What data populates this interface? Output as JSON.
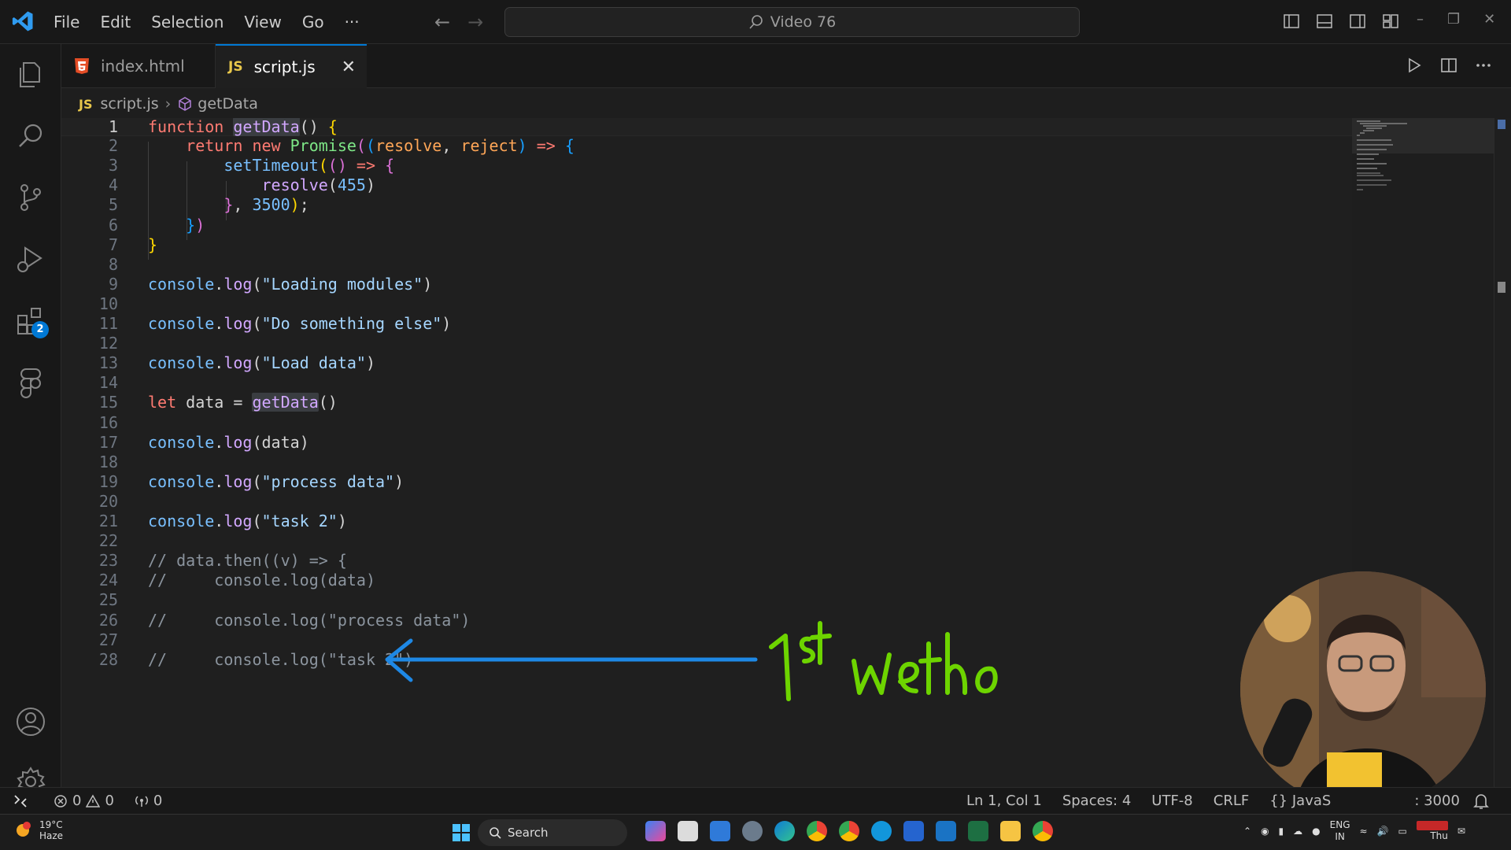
{
  "menu": {
    "items": [
      "File",
      "Edit",
      "Selection",
      "View",
      "Go",
      "···"
    ]
  },
  "command_center": {
    "label": "Video 76"
  },
  "activity_bar": {
    "extensions_badge": "2"
  },
  "tabs": [
    {
      "label": "index.html",
      "icon": "html5-icon"
    },
    {
      "label": "script.js",
      "icon": "js-icon",
      "badge": "JS"
    }
  ],
  "breadcrumb": {
    "file_badge": "JS",
    "file": "script.js",
    "symbol": "getData"
  },
  "editor": {
    "current_line": 1,
    "line_numbers": [
      "1",
      "2",
      "3",
      "4",
      "5",
      "6",
      "7",
      "8",
      "9",
      "10",
      "11",
      "12",
      "13",
      "14",
      "15",
      "16",
      "17",
      "18",
      "19",
      "20",
      "21",
      "22",
      "23",
      "24",
      "25",
      "26",
      "27",
      "28"
    ],
    "lines": [
      [
        {
          "t": "function",
          "c": "kw"
        },
        {
          "t": " ",
          "c": ""
        },
        {
          "t": "getData",
          "c": "fn hl"
        },
        {
          "t": "() ",
          "c": ""
        },
        {
          "t": "{",
          "c": "b1"
        }
      ],
      [
        {
          "t": "    return ",
          "c": "kw"
        },
        {
          "t": "new ",
          "c": "kw"
        },
        {
          "t": "Promise",
          "c": "fn2"
        },
        {
          "t": "(",
          "c": "b2"
        },
        {
          "t": "(",
          "c": "b3"
        },
        {
          "t": "resolve",
          "c": "param"
        },
        {
          "t": ", ",
          "c": ""
        },
        {
          "t": "reject",
          "c": "param"
        },
        {
          "t": ")",
          "c": "b3"
        },
        {
          "t": " => ",
          "c": "kw"
        },
        {
          "t": "{",
          "c": "b3"
        }
      ],
      [
        {
          "t": "        ",
          "c": ""
        },
        {
          "t": "setTimeout",
          "c": "obj"
        },
        {
          "t": "(",
          "c": "b1"
        },
        {
          "t": "()",
          "c": "b2"
        },
        {
          "t": " => ",
          "c": "kw"
        },
        {
          "t": "{",
          "c": "b2"
        }
      ],
      [
        {
          "t": "            ",
          "c": ""
        },
        {
          "t": "resolve",
          "c": "fn"
        },
        {
          "t": "(",
          "c": ""
        },
        {
          "t": "455",
          "c": "num"
        },
        {
          "t": ")",
          "c": ""
        }
      ],
      [
        {
          "t": "        ",
          "c": ""
        },
        {
          "t": "}",
          "c": "b2"
        },
        {
          "t": ", ",
          "c": ""
        },
        {
          "t": "3500",
          "c": "num"
        },
        {
          "t": ")",
          "c": "b1"
        },
        {
          "t": ";",
          "c": ""
        }
      ],
      [
        {
          "t": "    ",
          "c": ""
        },
        {
          "t": "}",
          "c": "b3"
        },
        {
          "t": ")",
          "c": "b2"
        }
      ],
      [
        {
          "t": "}",
          "c": "b1"
        }
      ],
      [],
      [
        {
          "t": "console",
          "c": "obj"
        },
        {
          "t": ".",
          "c": ""
        },
        {
          "t": "log",
          "c": "fn"
        },
        {
          "t": "(",
          "c": ""
        },
        {
          "t": "\"Loading modules\"",
          "c": "str"
        },
        {
          "t": ")",
          "c": ""
        }
      ],
      [],
      [
        {
          "t": "console",
          "c": "obj"
        },
        {
          "t": ".",
          "c": ""
        },
        {
          "t": "log",
          "c": "fn"
        },
        {
          "t": "(",
          "c": ""
        },
        {
          "t": "\"Do something else\"",
          "c": "str"
        },
        {
          "t": ")",
          "c": ""
        }
      ],
      [],
      [
        {
          "t": "console",
          "c": "obj"
        },
        {
          "t": ".",
          "c": ""
        },
        {
          "t": "log",
          "c": "fn"
        },
        {
          "t": "(",
          "c": ""
        },
        {
          "t": "\"Load data\"",
          "c": "str"
        },
        {
          "t": ")",
          "c": ""
        }
      ],
      [],
      [
        {
          "t": "let ",
          "c": "kw"
        },
        {
          "t": "data",
          "c": ""
        },
        {
          "t": " = ",
          "c": ""
        },
        {
          "t": "getData",
          "c": "fn hl"
        },
        {
          "t": "()",
          "c": ""
        }
      ],
      [],
      [
        {
          "t": "console",
          "c": "obj"
        },
        {
          "t": ".",
          "c": ""
        },
        {
          "t": "log",
          "c": "fn"
        },
        {
          "t": "(",
          "c": ""
        },
        {
          "t": "data",
          "c": ""
        },
        {
          "t": ")",
          "c": ""
        }
      ],
      [],
      [
        {
          "t": "console",
          "c": "obj"
        },
        {
          "t": ".",
          "c": ""
        },
        {
          "t": "log",
          "c": "fn"
        },
        {
          "t": "(",
          "c": ""
        },
        {
          "t": "\"process data\"",
          "c": "str"
        },
        {
          "t": ")",
          "c": ""
        }
      ],
      [],
      [
        {
          "t": "console",
          "c": "obj"
        },
        {
          "t": ".",
          "c": ""
        },
        {
          "t": "log",
          "c": "fn"
        },
        {
          "t": "(",
          "c": ""
        },
        {
          "t": "\"task 2\"",
          "c": "str"
        },
        {
          "t": ")",
          "c": ""
        }
      ],
      [],
      [
        {
          "t": "// data.then((v) => {",
          "c": "cmt"
        }
      ],
      [
        {
          "t": "//     console.log(data)",
          "c": "cmt"
        }
      ],
      [],
      [
        {
          "t": "//     console.log(\"process data\")",
          "c": "cmt"
        }
      ],
      [],
      [
        {
          "t": "//     console.log(\"task 2\")",
          "c": "cmt"
        }
      ]
    ]
  },
  "annotation": {
    "text": "1st method",
    "color": "#6dd400",
    "arrow_color": "#1e88e5"
  },
  "statusbar": {
    "errors": "0",
    "warnings": "0",
    "ports": "0",
    "position": "Ln 1, Col 1",
    "spaces": "Spaces: 4",
    "encoding": "UTF-8",
    "eol": "CRLF",
    "language": "{} JavaS",
    "port_partial": ": 3000"
  },
  "taskbar": {
    "weather_temp": "19°C",
    "weather_desc": "Haze",
    "search_label": "Search",
    "lang_top": "ENG",
    "lang_bottom": "IN",
    "day": "Thu"
  },
  "colors": {
    "accent": "#0078d4",
    "editor_bg": "#1f1f1f",
    "chrome_bg": "#181818"
  }
}
